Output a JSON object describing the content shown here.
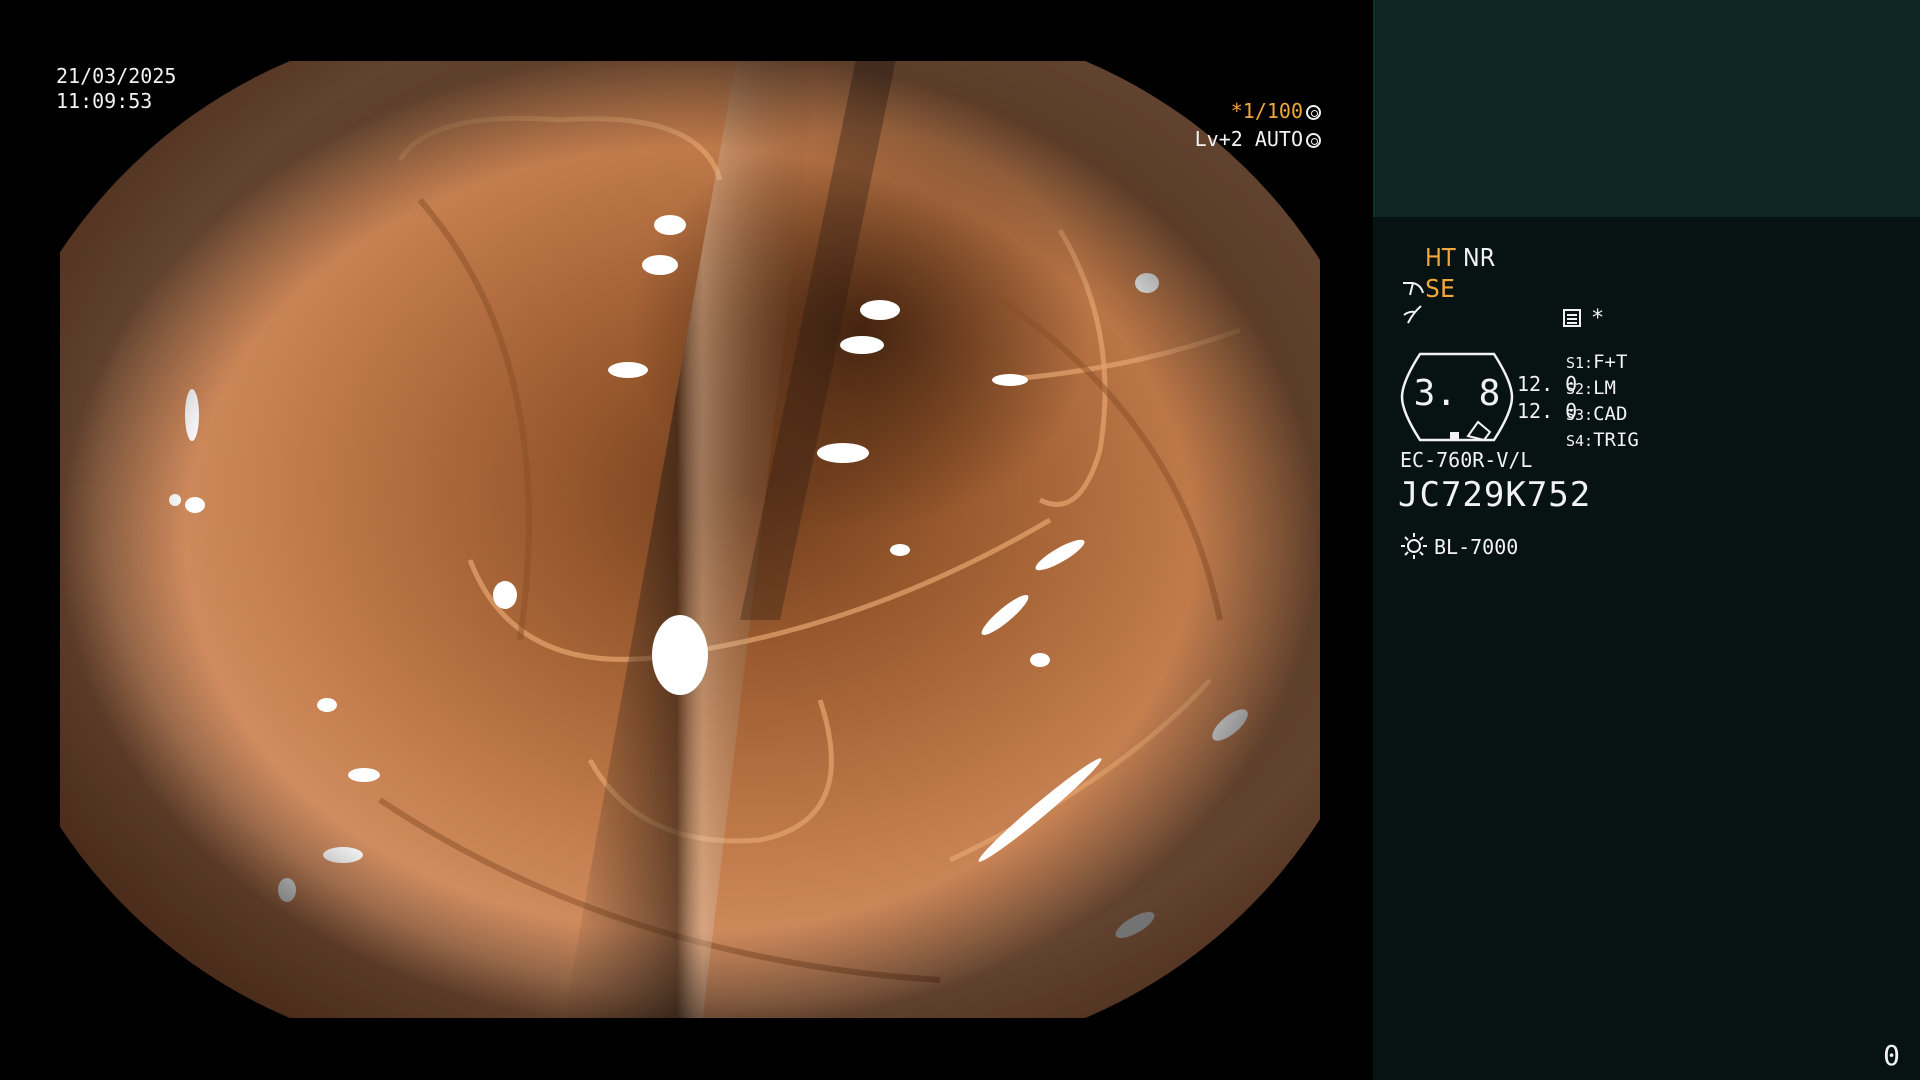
{
  "overlay": {
    "date": "21/03/2025",
    "time": "11:09:53",
    "shutter_star": "*",
    "shutter_value": "1/100",
    "level_label": "Lv+2 AUTO"
  },
  "status_panel": {
    "ht": "HT",
    "nr": "NR",
    "se": "SE",
    "star": "*",
    "zoom_value": "3. 8",
    "zoom_values": [
      "12. 0",
      "12. 0"
    ],
    "structure_slots": [
      {
        "key": "S1:",
        "value": "F+T"
      },
      {
        "key": "S2:",
        "value": "LM"
      },
      {
        "key": "S3:",
        "value": "CAD"
      },
      {
        "key": "S4:",
        "value": "TRIG"
      }
    ],
    "scope_model": "EC-760R-V/L",
    "scope_serial": "JC729K752",
    "light_source": "BL-7000",
    "frame_counter": "0"
  },
  "colors": {
    "accent_orange": "#f0a83a",
    "panel_dark": "#071213",
    "panel_teal": "#0d2525"
  },
  "icons": [
    "aperture-icon",
    "auto-iris-icon",
    "snare-icon",
    "enhance-icon",
    "menu-list-icon",
    "light-source-icon"
  ]
}
